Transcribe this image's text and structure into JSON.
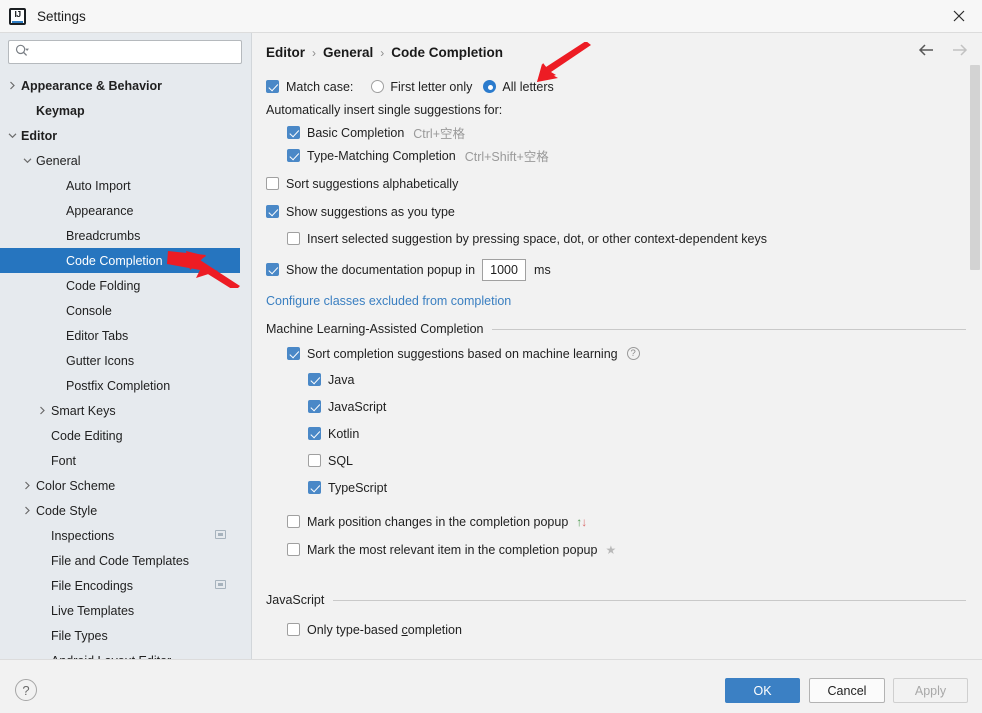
{
  "window": {
    "title": "Settings",
    "logo_icon": "intellij-idea-logo-icon",
    "close_icon": "close-icon"
  },
  "sidebar": {
    "search": {
      "value": "",
      "placeholder": "",
      "icon": "search-icon"
    },
    "tree": [
      {
        "label": "Appearance & Behavior",
        "indent": 0,
        "twisty": "chevron-right",
        "bold": true,
        "selected": false,
        "icon": ""
      },
      {
        "label": "Keymap",
        "indent": 1,
        "twisty": "none",
        "bold": true,
        "selected": false,
        "icon": ""
      },
      {
        "label": "Editor",
        "indent": 0,
        "twisty": "chevron-down",
        "bold": true,
        "selected": false,
        "icon": ""
      },
      {
        "label": "General",
        "indent": 1,
        "twisty": "chevron-down",
        "bold": false,
        "selected": false,
        "icon": ""
      },
      {
        "label": "Auto Import",
        "indent": 3,
        "twisty": "none",
        "bold": false,
        "selected": false,
        "icon": ""
      },
      {
        "label": "Appearance",
        "indent": 3,
        "twisty": "none",
        "bold": false,
        "selected": false,
        "icon": ""
      },
      {
        "label": "Breadcrumbs",
        "indent": 3,
        "twisty": "none",
        "bold": false,
        "selected": false,
        "icon": ""
      },
      {
        "label": "Code Completion",
        "indent": 3,
        "twisty": "none",
        "bold": false,
        "selected": true,
        "icon": ""
      },
      {
        "label": "Code Folding",
        "indent": 3,
        "twisty": "none",
        "bold": false,
        "selected": false,
        "icon": ""
      },
      {
        "label": "Console",
        "indent": 3,
        "twisty": "none",
        "bold": false,
        "selected": false,
        "icon": ""
      },
      {
        "label": "Editor Tabs",
        "indent": 3,
        "twisty": "none",
        "bold": false,
        "selected": false,
        "icon": ""
      },
      {
        "label": "Gutter Icons",
        "indent": 3,
        "twisty": "none",
        "bold": false,
        "selected": false,
        "icon": ""
      },
      {
        "label": "Postfix Completion",
        "indent": 3,
        "twisty": "none",
        "bold": false,
        "selected": false,
        "icon": ""
      },
      {
        "label": "Smart Keys",
        "indent": 2,
        "twisty": "chevron-right",
        "bold": false,
        "selected": false,
        "icon": ""
      },
      {
        "label": "Code Editing",
        "indent": 2,
        "twisty": "none",
        "bold": false,
        "selected": false,
        "icon": ""
      },
      {
        "label": "Font",
        "indent": 2,
        "twisty": "none",
        "bold": false,
        "selected": false,
        "icon": ""
      },
      {
        "label": "Color Scheme",
        "indent": 1,
        "twisty": "chevron-right",
        "bold": false,
        "selected": false,
        "icon": ""
      },
      {
        "label": "Code Style",
        "indent": 1,
        "twisty": "chevron-right",
        "bold": false,
        "selected": false,
        "icon": ""
      },
      {
        "label": "Inspections",
        "indent": 2,
        "twisty": "none",
        "bold": false,
        "selected": false,
        "icon": "scope-icon"
      },
      {
        "label": "File and Code Templates",
        "indent": 2,
        "twisty": "none",
        "bold": false,
        "selected": false,
        "icon": ""
      },
      {
        "label": "File Encodings",
        "indent": 2,
        "twisty": "none",
        "bold": false,
        "selected": false,
        "icon": "scope-icon"
      },
      {
        "label": "Live Templates",
        "indent": 2,
        "twisty": "none",
        "bold": false,
        "selected": false,
        "icon": ""
      },
      {
        "label": "File Types",
        "indent": 2,
        "twisty": "none",
        "bold": false,
        "selected": false,
        "icon": ""
      },
      {
        "label": "Android Layout Editor",
        "indent": 2,
        "twisty": "none",
        "bold": false,
        "selected": false,
        "icon": ""
      }
    ]
  },
  "main": {
    "breadcrumb": [
      "Editor",
      "General",
      "Code Completion"
    ],
    "breadcrumb_separator": "›",
    "nav": {
      "back_icon": "arrow-left-icon",
      "forward_icon": "arrow-right-icon"
    },
    "match_case": {
      "label": "Match case:",
      "checked": true,
      "options": [
        {
          "label": "First letter only",
          "selected": false
        },
        {
          "label": "All letters",
          "selected": true
        }
      ]
    },
    "auto_insert_label": "Automatically insert single suggestions for:",
    "auto_insert_items": [
      {
        "label": "Basic Completion",
        "shortcut": "Ctrl+空格",
        "checked": true
      },
      {
        "label": "Type-Matching Completion",
        "shortcut": "Ctrl+Shift+空格",
        "checked": true
      }
    ],
    "sort_alphabetically": {
      "label": "Sort suggestions alphabetically",
      "checked": false
    },
    "show_as_you_type": {
      "label": "Show suggestions as you type",
      "checked": true
    },
    "insert_selected": {
      "label": "Insert selected suggestion by pressing space, dot, or other context-dependent keys",
      "checked": false
    },
    "doc_popup": {
      "label_before": "Show the documentation popup in",
      "value": "1000",
      "label_after": "ms",
      "checked": true
    },
    "excluded_link": "Configure classes excluded from completion",
    "ml_section": {
      "title": "Machine Learning-Assisted Completion",
      "sort_ml": {
        "label": "Sort completion suggestions based on machine learning",
        "checked": true,
        "help_icon": "help-icon"
      },
      "languages": [
        {
          "label": "Java",
          "checked": true
        },
        {
          "label": "JavaScript",
          "checked": true
        },
        {
          "label": "Kotlin",
          "checked": true
        },
        {
          "label": "SQL",
          "checked": false
        },
        {
          "label": "TypeScript",
          "checked": true
        }
      ],
      "mark_position": {
        "label": "Mark position changes in the completion popup",
        "checked": false,
        "glyph_up": "↑",
        "glyph_down": "↓"
      },
      "mark_relevant": {
        "label": "Mark the most relevant item in the completion popup",
        "checked": false,
        "glyph": "★"
      }
    },
    "js_section": {
      "title": "JavaScript",
      "only_type_based": {
        "label_a": "Only type-based ",
        "label_mnemonic": "c",
        "label_b": "ompletion",
        "checked": false
      }
    }
  },
  "footer": {
    "help_label": "?",
    "ok_label": "OK",
    "cancel_label": "Cancel",
    "apply_label": "Apply"
  },
  "colors": {
    "accent": "#2675bf",
    "checkbox_on": "#4a88c7",
    "radio_on": "#2b7bcd",
    "link": "#3a7fc1",
    "annotation": "#ed1c24",
    "sidebar_bg": "#e6eaee",
    "panel_bg": "#f2f2f2"
  }
}
